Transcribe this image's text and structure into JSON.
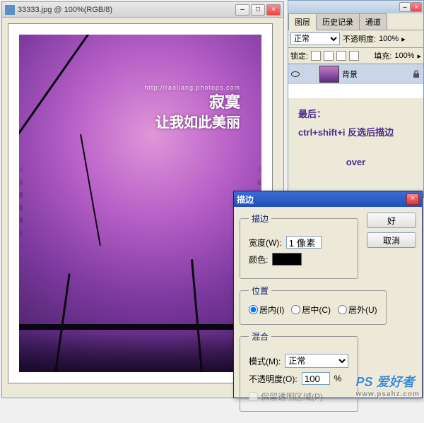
{
  "document": {
    "title": "33333.jpg @ 100%(RGB/8)",
    "artwork_url": "http://raoliang.photops.com",
    "artwork_line1": "寂寞",
    "artwork_line2": "让我如此美丽"
  },
  "layers_panel": {
    "tabs": [
      "图层",
      "历史记录",
      "通道"
    ],
    "blend_mode": "正常",
    "opacity_label": "不透明度:",
    "opacity_value": "100%",
    "lock_label": "锁定:",
    "fill_label": "填充:",
    "fill_value": "100%",
    "layer_name": "背景"
  },
  "notes": {
    "line1": "最后：",
    "line2": "ctrl+shift+i 反选后描边",
    "line3": "over"
  },
  "stroke_dialog": {
    "title": "描边",
    "section_stroke": "描边",
    "width_label": "宽度(W):",
    "width_value": "1 像素",
    "color_label": "颜色:",
    "section_position": "位置",
    "pos_inside": "居内(I)",
    "pos_center": "居中(C)",
    "pos_outside": "居外(U)",
    "section_blend": "混合",
    "mode_label": "模式(M):",
    "mode_value": "正常",
    "opacity_label": "不透明度(O):",
    "opacity_value": "100",
    "opacity_pct": "%",
    "preserve_label": "保留透明区域(P)",
    "btn_ok": "好",
    "btn_cancel": "取消"
  },
  "watermark": {
    "logo": "PS 爱好者",
    "url": "www.psahz.com"
  }
}
